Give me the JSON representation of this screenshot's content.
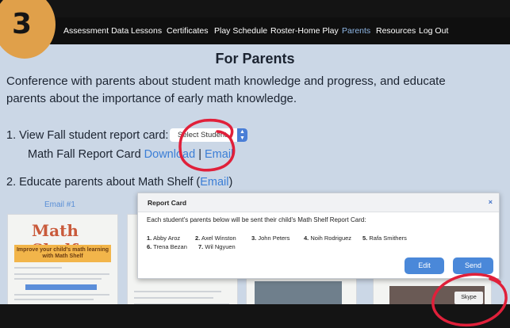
{
  "badge": {
    "number": "3"
  },
  "nav": {
    "items": [
      {
        "label": "Assessment Data",
        "active": false
      },
      {
        "label": "Lessons",
        "active": false
      },
      {
        "label": "Certificates",
        "active": false
      },
      {
        "label": "Play Schedule",
        "active": false
      },
      {
        "label": "Roster-Home Play",
        "active": false
      },
      {
        "label": "Parents",
        "active": true
      },
      {
        "label": "Resources",
        "active": false
      },
      {
        "label": "Log Out",
        "active": false
      }
    ]
  },
  "page": {
    "title": "For Parents",
    "intro_line1": "Conference with parents about student math knowledge and progress, and educate",
    "intro_line2": "parents about the importance of early math knowledge.",
    "step1_label": "1. View Fall student report card:",
    "select_value": "Select Student",
    "report_label": "Math Fall Report Card",
    "download_link": "Download",
    "separator": "|",
    "email_link": "Email",
    "step2_label": "2. Educate parents about Math Shelf (",
    "step2_link": "Email",
    "step2_end": ")",
    "email_card_label": "Email #1",
    "logo_text": "Math Shelf",
    "banner_text": "Improve your child's math learning with Math Shelf"
  },
  "modal": {
    "title": "Report Card",
    "close": "×",
    "description": "Each student's parents below will be sent their child's Math Shelf Report Card:",
    "students": [
      {
        "num": "1.",
        "name": "Abby Aroz"
      },
      {
        "num": "2.",
        "name": "Axel Winston"
      },
      {
        "num": "3.",
        "name": "John Peters"
      },
      {
        "num": "4.",
        "name": "Noih Rodriguez"
      },
      {
        "num": "5.",
        "name": "Rafa Smithers"
      },
      {
        "num": "6.",
        "name": "Trena Bezan"
      },
      {
        "num": "7.",
        "name": "Wil Ngyuen"
      }
    ],
    "edit_label": "Edit",
    "send_label": "Send"
  },
  "skype": {
    "label": "Skype"
  },
  "colors": {
    "page_bg": "#cbd7e6",
    "nav_bg": "#0f0f0f",
    "active_nav": "#8fb7e6",
    "link": "#3b7ed6",
    "button": "#4a88d9",
    "badge": "#e0a04a",
    "annotation": "#e0203a"
  }
}
